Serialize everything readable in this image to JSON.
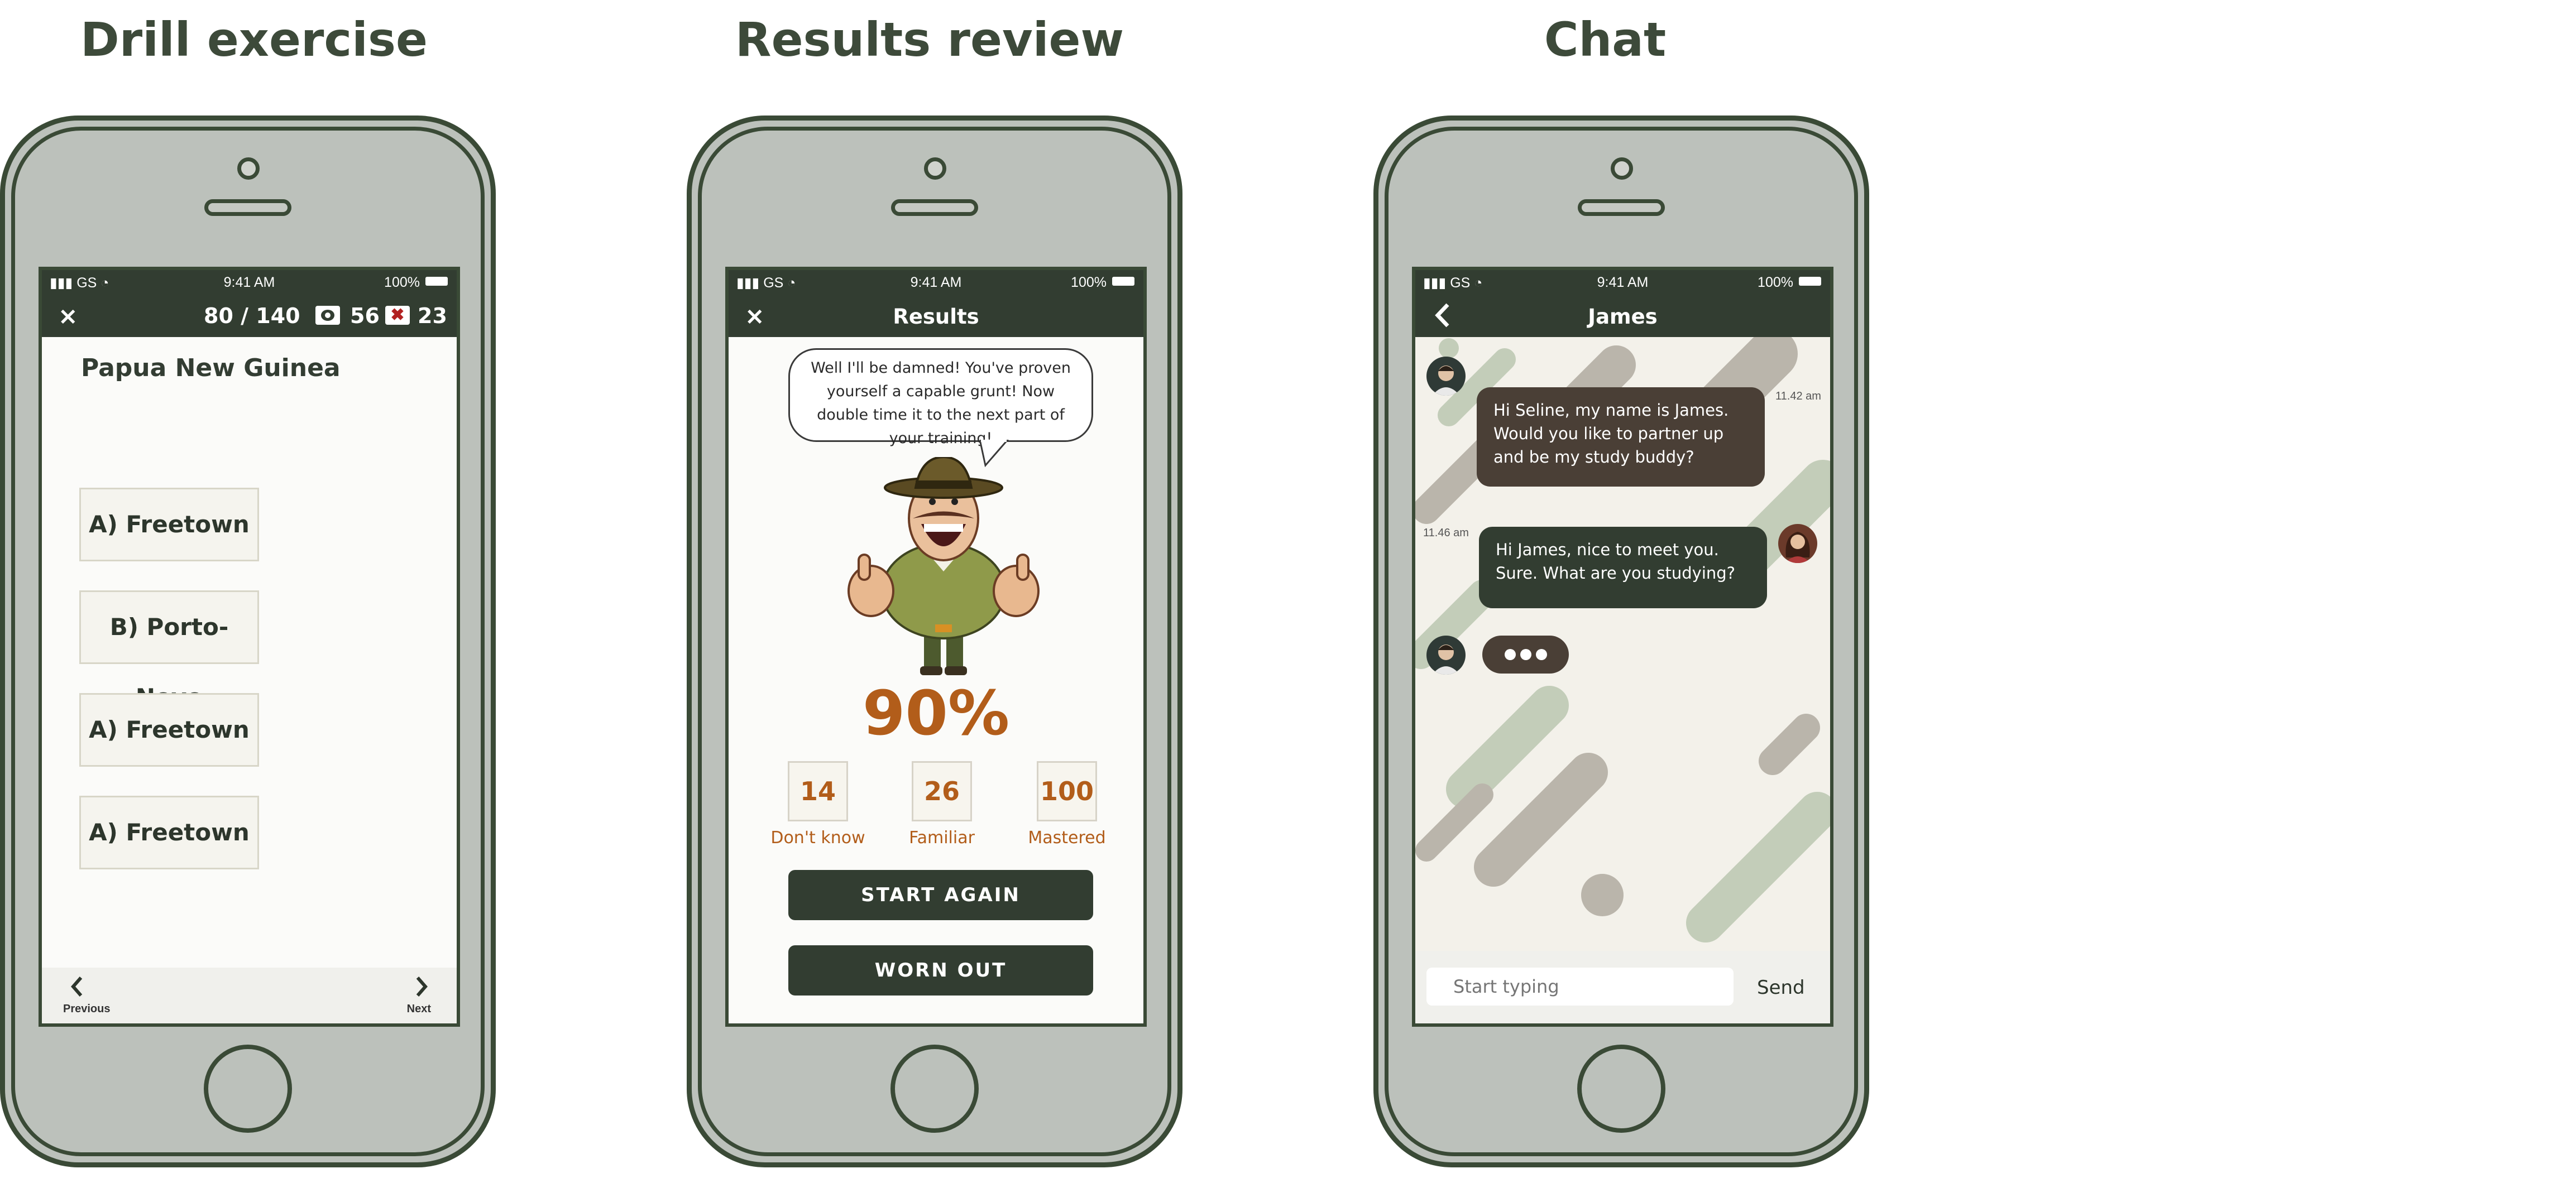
{
  "titles": {
    "drill": "Drill exercise",
    "results": "Results review",
    "chat": "Chat"
  },
  "status": {
    "signal": "GS",
    "time": "9:41 AM",
    "battery": "100%"
  },
  "drill": {
    "progress": "80 / 140",
    "seen_count": "56",
    "wrong_count": "23",
    "question": "Papua New Guinea",
    "options": [
      "A) Freetown",
      "B) Porto-Novo",
      "A) Freetown",
      "A) Freetown"
    ],
    "prev_label": "Previous",
    "next_label": "Next"
  },
  "results": {
    "title": "Results",
    "speech": "Well I'll be damned! You've proven yourself a capable grunt! Now double time it to the next part of your training!",
    "score": "90%",
    "stats": [
      {
        "value": "14",
        "label": "Don't know"
      },
      {
        "value": "26",
        "label": "Familiar"
      },
      {
        "value": "100",
        "label": "Mastered"
      }
    ],
    "btn_again": "START AGAIN",
    "btn_worn": "WORN OUT"
  },
  "chat": {
    "title": "James",
    "messages": [
      {
        "text": "Hi Seline, my name is James. Would you like to partner up and be my study buddy?",
        "time": "11.42 am"
      },
      {
        "text": "Hi James, nice to meet you. Sure. What are you studying?",
        "time": "11.46 am"
      }
    ],
    "input_placeholder": "Start typing",
    "send_label": "Send"
  },
  "colors": {
    "dark_green": "#323d31",
    "accent_orange": "#b25d1a",
    "bubble_brown": "#4a3f36",
    "phone_grey": "#bcc1bb"
  }
}
